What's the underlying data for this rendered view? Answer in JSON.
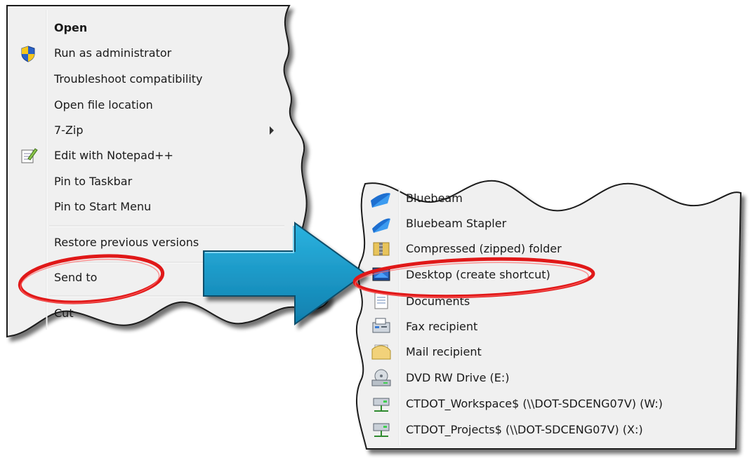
{
  "context_menu": {
    "items": [
      {
        "label": "Open",
        "bold": true,
        "icon": "shield-icon-none"
      },
      {
        "label": "Run as administrator",
        "icon": "uac-shield-icon"
      },
      {
        "label": "Troubleshoot compatibility"
      },
      {
        "label": "Open file location"
      },
      {
        "label": "7-Zip",
        "has_submenu": true
      },
      {
        "label": "Edit with Notepad++",
        "icon": "notepad-plus-icon"
      },
      {
        "label": "Pin to Taskbar"
      },
      {
        "label": "Pin to Start Menu"
      },
      {
        "label": "Restore previous versions"
      },
      {
        "label": "Send to",
        "highlighted": true
      },
      {
        "label": "Cut"
      }
    ]
  },
  "send_to_menu": {
    "items": [
      {
        "label": "Bluebeam",
        "icon": "bluebeam-icon"
      },
      {
        "label": "Bluebeam Stapler",
        "icon": "bluebeam-stapler-icon"
      },
      {
        "label": "Compressed (zipped) folder",
        "icon": "zip-folder-icon"
      },
      {
        "label": "Desktop (create shortcut)",
        "icon": "desktop-icon",
        "highlighted": true
      },
      {
        "label": "Documents",
        "icon": "documents-icon"
      },
      {
        "label": "Fax recipient",
        "icon": "fax-icon"
      },
      {
        "label": "Mail recipient",
        "icon": "mail-icon"
      },
      {
        "label": "DVD RW Drive (E:)",
        "icon": "dvd-drive-icon"
      },
      {
        "label": "CTDOT_Workspace$ (\\\\DOT-SDCENG07V) (W:)",
        "icon": "network-drive-icon"
      },
      {
        "label": "CTDOT_Projects$ (\\\\DOT-SDCENG07V) (X:)",
        "icon": "network-drive-icon"
      }
    ]
  },
  "colors": {
    "menu_bg": "#f0f0f0",
    "menu_border": "#1a1a1a",
    "arrow_blue": "#1a9ac8",
    "arrow_dark": "#0d5f80",
    "highlight_red": "#e01818"
  }
}
